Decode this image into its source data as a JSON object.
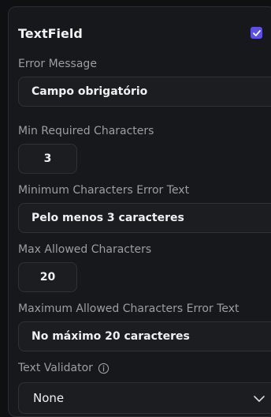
{
  "panel": {
    "title": "TextField",
    "enabled": true
  },
  "fields": {
    "error_message": {
      "label": "Error Message",
      "value": "Campo obrigatório"
    },
    "min_chars": {
      "label": "Min Required Characters",
      "value": "3"
    },
    "min_error": {
      "label": "Minimum Characters Error Text",
      "value": "Pelo menos 3 caracteres"
    },
    "max_chars": {
      "label": "Max Allowed Characters",
      "value": "20"
    },
    "max_error": {
      "label": "Maximum Allowed Characters Error Text",
      "value": "No máximo 20 caracteres"
    },
    "validator": {
      "label": "Text Validator",
      "selected": "None"
    }
  },
  "colors": {
    "accent": "#5b4fe6",
    "background": "#16181b",
    "field_bg": "#1b1d21",
    "label": "#9b9ea3"
  },
  "icons": {
    "checkbox": "check-icon",
    "info": "info-icon",
    "dropdown": "chevron-down-icon"
  }
}
